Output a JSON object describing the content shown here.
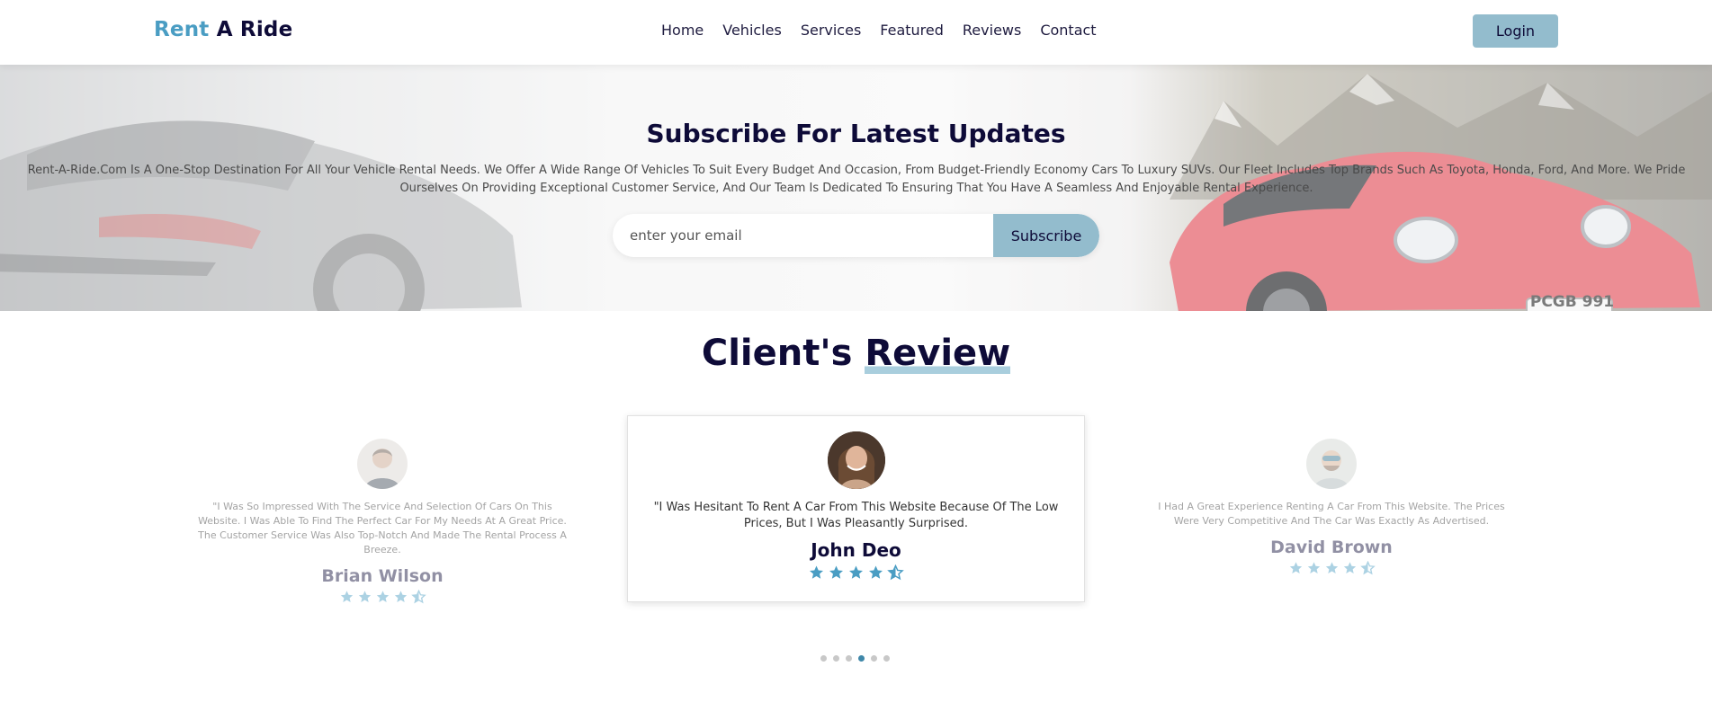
{
  "header": {
    "logo_part1": "Rent",
    "logo_part2": "A Ride",
    "nav": [
      "Home",
      "Vehicles",
      "Services",
      "Featured",
      "Reviews",
      "Contact"
    ],
    "login_label": "Login"
  },
  "hero": {
    "title": "Subscribe For Latest Updates",
    "description": "Rent-A-Ride.Com Is A One-Stop Destination For All Your Vehicle Rental Needs. We Offer A Wide Range Of Vehicles To Suit Every Budget And Occasion, From Budget-Friendly Economy Cars To Luxury SUVs. Our Fleet Includes Top Brands Such As Toyota, Honda, Ford, And More. We Pride Ourselves On Providing Exceptional Customer Service, And Our Team Is Dedicated To Ensuring That You Have A Seamless And Enjoyable Rental Experience.",
    "email_placeholder": "enter your email",
    "subscribe_label": "Subscribe",
    "car_plate": "PCGB 991"
  },
  "reviews": {
    "title_part1": "Client's ",
    "title_part2": "Review",
    "items": [
      {
        "quote": "\"I Was So Impressed With The Service And Selection Of Cars On This Website. I Was Able To Find The Perfect Car For My Needs At A Great Price. The Customer Service Was Also Top-Notch And Made The Rental Process A Breeze.",
        "name": "Brian Wilson",
        "rating": 4.5
      },
      {
        "quote": "\"I Was Hesitant To Rent A Car From This Website Because Of The Low Prices, But I Was Pleasantly Surprised.",
        "name": "John Deo",
        "rating": 4.5
      },
      {
        "quote": "I Had A Great Experience Renting A Car From This Website. The Prices Were Very Competitive And The Car Was Exactly As Advertised.",
        "name": "David Brown",
        "rating": 4.5
      }
    ],
    "dots_count": 6,
    "active_dot": 4
  },
  "colors": {
    "accent": "#4a9dc3",
    "button": "#93bccd",
    "navy": "#0e0b38",
    "star": "#4a9dc3"
  }
}
